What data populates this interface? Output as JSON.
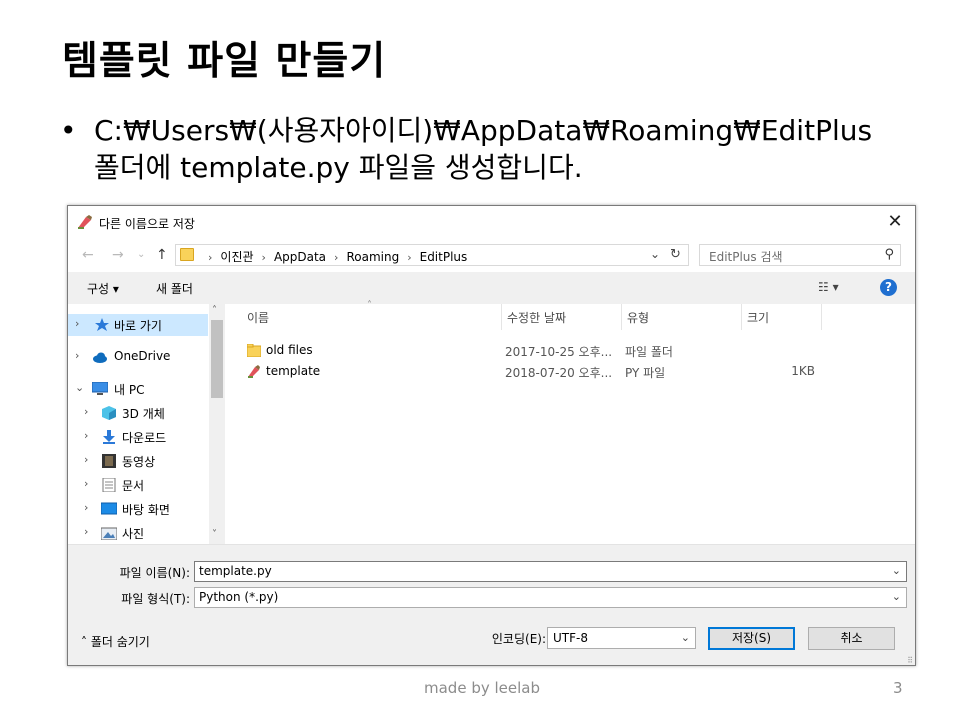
{
  "slide": {
    "title": "템플릿 파일 만들기",
    "bullet_marker": "•",
    "bullet_line1": "C:₩Users₩(사용자아이디)₩AppData₩Roaming₩EditPlus",
    "bullet_line2": "폴더에 template.py 파일을 생성합니다.",
    "footer_text": "made by leelab",
    "page_number": "3"
  },
  "dialog": {
    "title": "다른 이름으로 저장",
    "close_glyph": "✕",
    "nav": {
      "back": "←",
      "forward": "→",
      "recent": "⌄",
      "up": "↑"
    },
    "breadcrumbs": [
      "이진관",
      "AppData",
      "Roaming",
      "EditPlus"
    ],
    "breadcrumb_separator": "›",
    "address_dropdown": "⌄",
    "refresh_glyph": "↻",
    "search_placeholder": "EditPlus 검색",
    "search_glyph": "⚲",
    "toolbar": {
      "organize": "구성 ▾",
      "new_folder": "새 폴더",
      "view_glyph": "☷ ▾",
      "help": "?"
    },
    "nav_items": [
      {
        "label": "바로 가기",
        "icon": "star-icon",
        "chevron": "›",
        "selected": true
      },
      {
        "label": "OneDrive",
        "icon": "cloud-icon",
        "chevron": "›",
        "selected": false
      },
      {
        "label": "내 PC",
        "icon": "computer-icon",
        "chevron": "⌄",
        "selected": false
      },
      {
        "label": "3D 개체",
        "icon": "cube-icon",
        "chevron": "›",
        "selected": false
      },
      {
        "label": "다운로드",
        "icon": "download-icon",
        "chevron": "›",
        "selected": false
      },
      {
        "label": "동영상",
        "icon": "video-icon",
        "chevron": "›",
        "selected": false
      },
      {
        "label": "문서",
        "icon": "document-icon",
        "chevron": "›",
        "selected": false
      },
      {
        "label": "바탕 화면",
        "icon": "desktop-icon",
        "chevron": "›",
        "selected": false
      },
      {
        "label": "사진",
        "icon": "picture-icon",
        "chevron": "›",
        "selected": false
      }
    ],
    "scroll": {
      "up": "˄",
      "down": "˅"
    },
    "columns": {
      "name": "이름",
      "modified": "수정한 날짜",
      "type": "유형",
      "size": "크기",
      "sort_caret": "˄"
    },
    "files": [
      {
        "name": "old files",
        "modified": "2017-10-25 오후...",
        "type": "파일 폴더",
        "size": "",
        "icon": "folder-icon"
      },
      {
        "name": "template",
        "modified": "2018-07-20 오후...",
        "type": "PY 파일",
        "size": "1KB",
        "icon": "editplus-file-icon"
      }
    ],
    "filename_label": "파일 이름(N):",
    "filename_value": "template.py",
    "filetype_label": "파일 형식(T):",
    "filetype_value": "Python (*.py)",
    "field_dropdown": "⌄",
    "hide_folders": "˄  폴더 숨기기",
    "encoding_label": "인코딩(E):",
    "encoding_value": "UTF-8",
    "save_button": "저장(S)",
    "cancel_button": "취소",
    "grip": "⠿"
  },
  "colors": {
    "selection": "#cce8ff",
    "accent": "#0078d7",
    "help_blue": "#1f6fd0",
    "folder_yellow": "#f9d25a"
  }
}
